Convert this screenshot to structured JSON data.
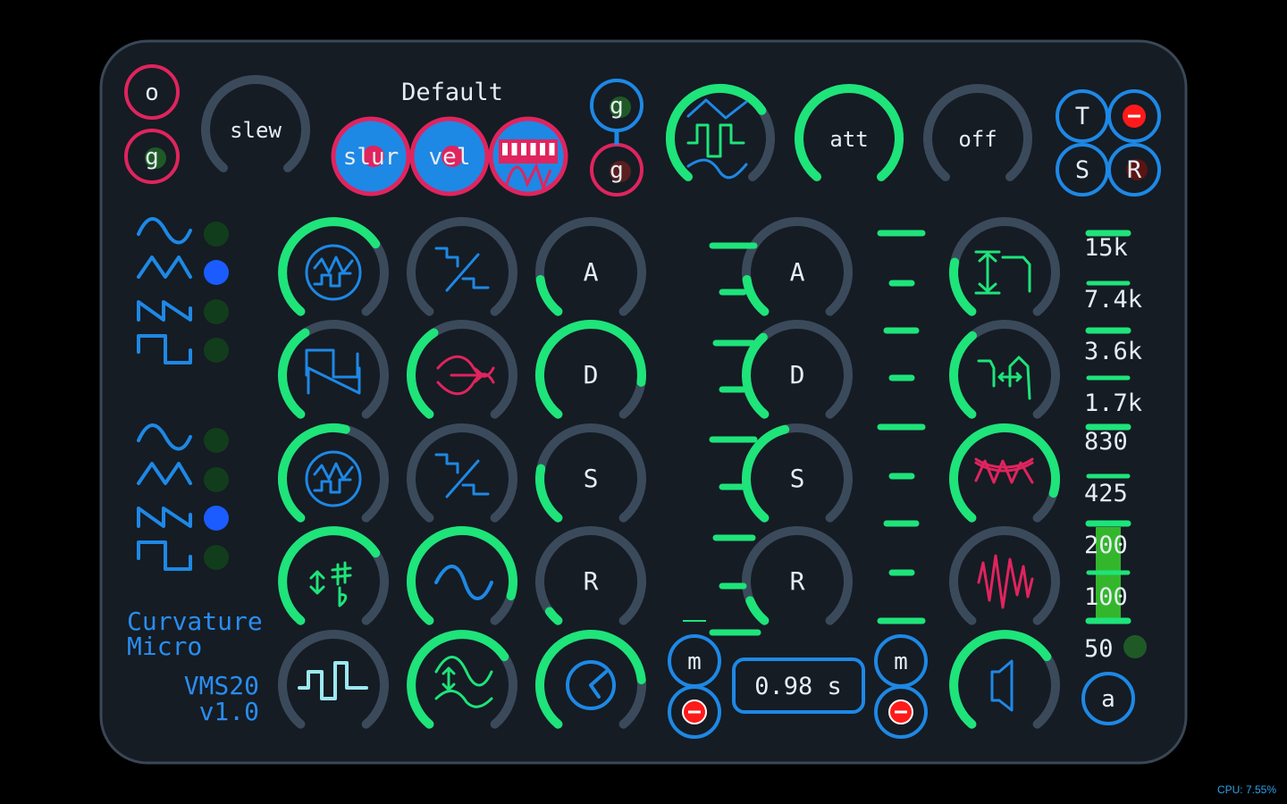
{
  "colors": {
    "background": "#000000",
    "panel": "#151c24",
    "panel_border": "#3a4756",
    "knob_track": "#3b4a5b",
    "knob_value": "#1ee47a",
    "blue": "#1e88e5",
    "pink": "#e0245e",
    "text": "#e6edf3",
    "led_off": "#123d1c",
    "led_on": "#1a5cff"
  },
  "header": {
    "preset_name": "Default",
    "slew_label": "slew",
    "slur_label": "slur",
    "vel_label": "vel",
    "att_label": "att",
    "off_label": "off",
    "o_button": "o",
    "g_label": "g"
  },
  "transport": {
    "t": "T",
    "s": "S",
    "r": "R"
  },
  "knobs": [
    {
      "id": "slew",
      "value": 0.0,
      "label": "slew"
    },
    {
      "id": "wave-mod",
      "value": 0.7
    },
    {
      "id": "att",
      "value": 1.0,
      "label": "att"
    },
    {
      "id": "off",
      "value": 0.0,
      "label": "off"
    },
    {
      "id": "osc1-mix",
      "value": 0.7
    },
    {
      "id": "osc1-quant",
      "value": 0.0
    },
    {
      "id": "env1-attack",
      "value": 0.15,
      "label": "A"
    },
    {
      "id": "osc1-shape",
      "value": 0.38
    },
    {
      "id": "osc1-phase",
      "value": 0.38
    },
    {
      "id": "env1-decay",
      "value": 0.85,
      "label": "D"
    },
    {
      "id": "osc2-mix",
      "value": 0.55
    },
    {
      "id": "osc2-quant",
      "value": 0.0
    },
    {
      "id": "env1-sustain",
      "value": 0.22,
      "label": "S"
    },
    {
      "id": "transpose",
      "value": 0.7
    },
    {
      "id": "sine-mod",
      "value": 0.88
    },
    {
      "id": "env1-release",
      "value": 0.05,
      "label": "R"
    },
    {
      "id": "pulse-width",
      "value": 0.0
    },
    {
      "id": "fm-amount",
      "value": 0.7
    },
    {
      "id": "clock-rate",
      "value": 0.8
    },
    {
      "id": "env2-attack",
      "value": 0.15,
      "label": "A"
    },
    {
      "id": "env2-decay",
      "value": 0.35,
      "label": "D"
    },
    {
      "id": "env2-sustain",
      "value": 0.45,
      "label": "S"
    },
    {
      "id": "env2-release",
      "value": 0.1,
      "label": "R"
    },
    {
      "id": "filter-cutoff",
      "value": 0.22
    },
    {
      "id": "filter-reso",
      "value": 0.36
    },
    {
      "id": "filter-drive",
      "value": 0.88
    },
    {
      "id": "filter-noise",
      "value": 0.0
    },
    {
      "id": "volume",
      "value": 0.7
    }
  ],
  "osc_leds": {
    "group1": [
      false,
      true,
      false,
      false
    ],
    "group2": [
      false,
      false,
      true,
      false
    ]
  },
  "spectrum": {
    "labels": [
      "15k",
      "7.4k",
      "3.6k",
      "1.7k",
      "830",
      "425",
      "200",
      "100",
      "50"
    ],
    "level": 0.32
  },
  "time_readout": "0.98 s",
  "m_label": "m",
  "a_label": "a",
  "brand": {
    "line1": "Curvature",
    "line2": "Micro",
    "model": "VMS20",
    "version": "v1.0"
  },
  "cpu": "CPU: 7.55%"
}
